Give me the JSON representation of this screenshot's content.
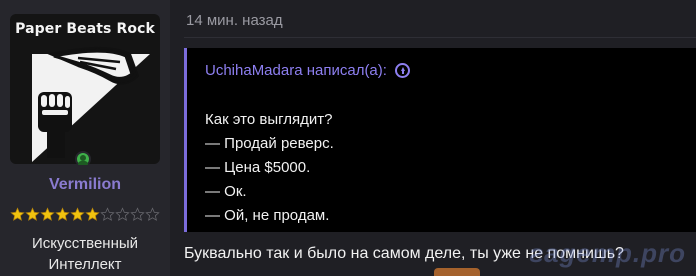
{
  "user": {
    "avatar_text": "Paper Beats Rock",
    "username": "Vermilion",
    "title": "Искусственный Интеллект",
    "rating": {
      "filled": 6,
      "total": 10
    },
    "online": true,
    "username_color": "#8a7bd0"
  },
  "message": {
    "timestamp": "14 мин. назад",
    "quote": {
      "author_line": "UchihaMadara написал(а):",
      "lines": [
        "Как это выглядит?",
        "— Продай реверс.",
        "— Цена $5000.",
        "— Ок.",
        "— Ой, не продам."
      ]
    },
    "reply": "Буквально так и было на самом деле, ты уже не помнишь?"
  },
  "watermark": "гаgemp.pro",
  "icons": {
    "online": "user-online-icon",
    "quote_jump": "arrow-up-circle-icon",
    "star": "star-icon"
  },
  "colors": {
    "accent": "#8d7ff0",
    "star_filled": "#f1c40f",
    "online": "#3fb14a"
  }
}
